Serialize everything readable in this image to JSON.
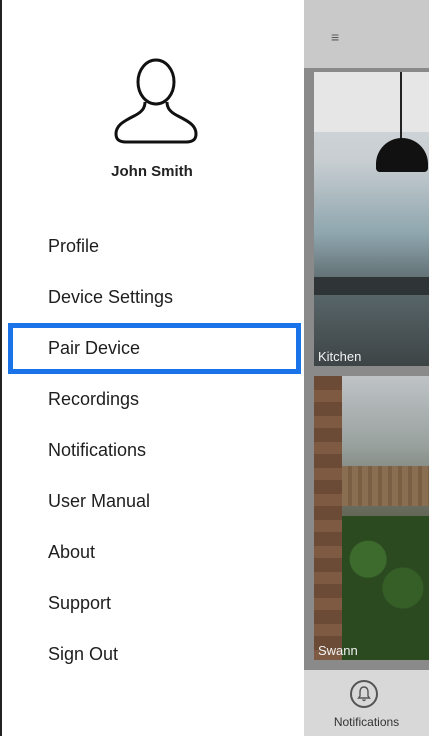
{
  "user": {
    "name": "John Smith"
  },
  "menu": {
    "items": [
      {
        "label": "Profile"
      },
      {
        "label": "Device Settings"
      },
      {
        "label": "Pair Device"
      },
      {
        "label": "Recordings"
      },
      {
        "label": "Notifications"
      },
      {
        "label": "User Manual"
      },
      {
        "label": "About"
      },
      {
        "label": "Support"
      },
      {
        "label": "Sign Out"
      }
    ],
    "selected": "Pair Device",
    "highlight_color": "#1a73e8"
  },
  "background_app": {
    "menu_icon": "hamburger-icon",
    "cameras": [
      {
        "name": "Kitchen"
      },
      {
        "name": "Swann"
      }
    ],
    "bottom_nav": {
      "label": "Notifications",
      "icon": "bell-icon"
    }
  }
}
